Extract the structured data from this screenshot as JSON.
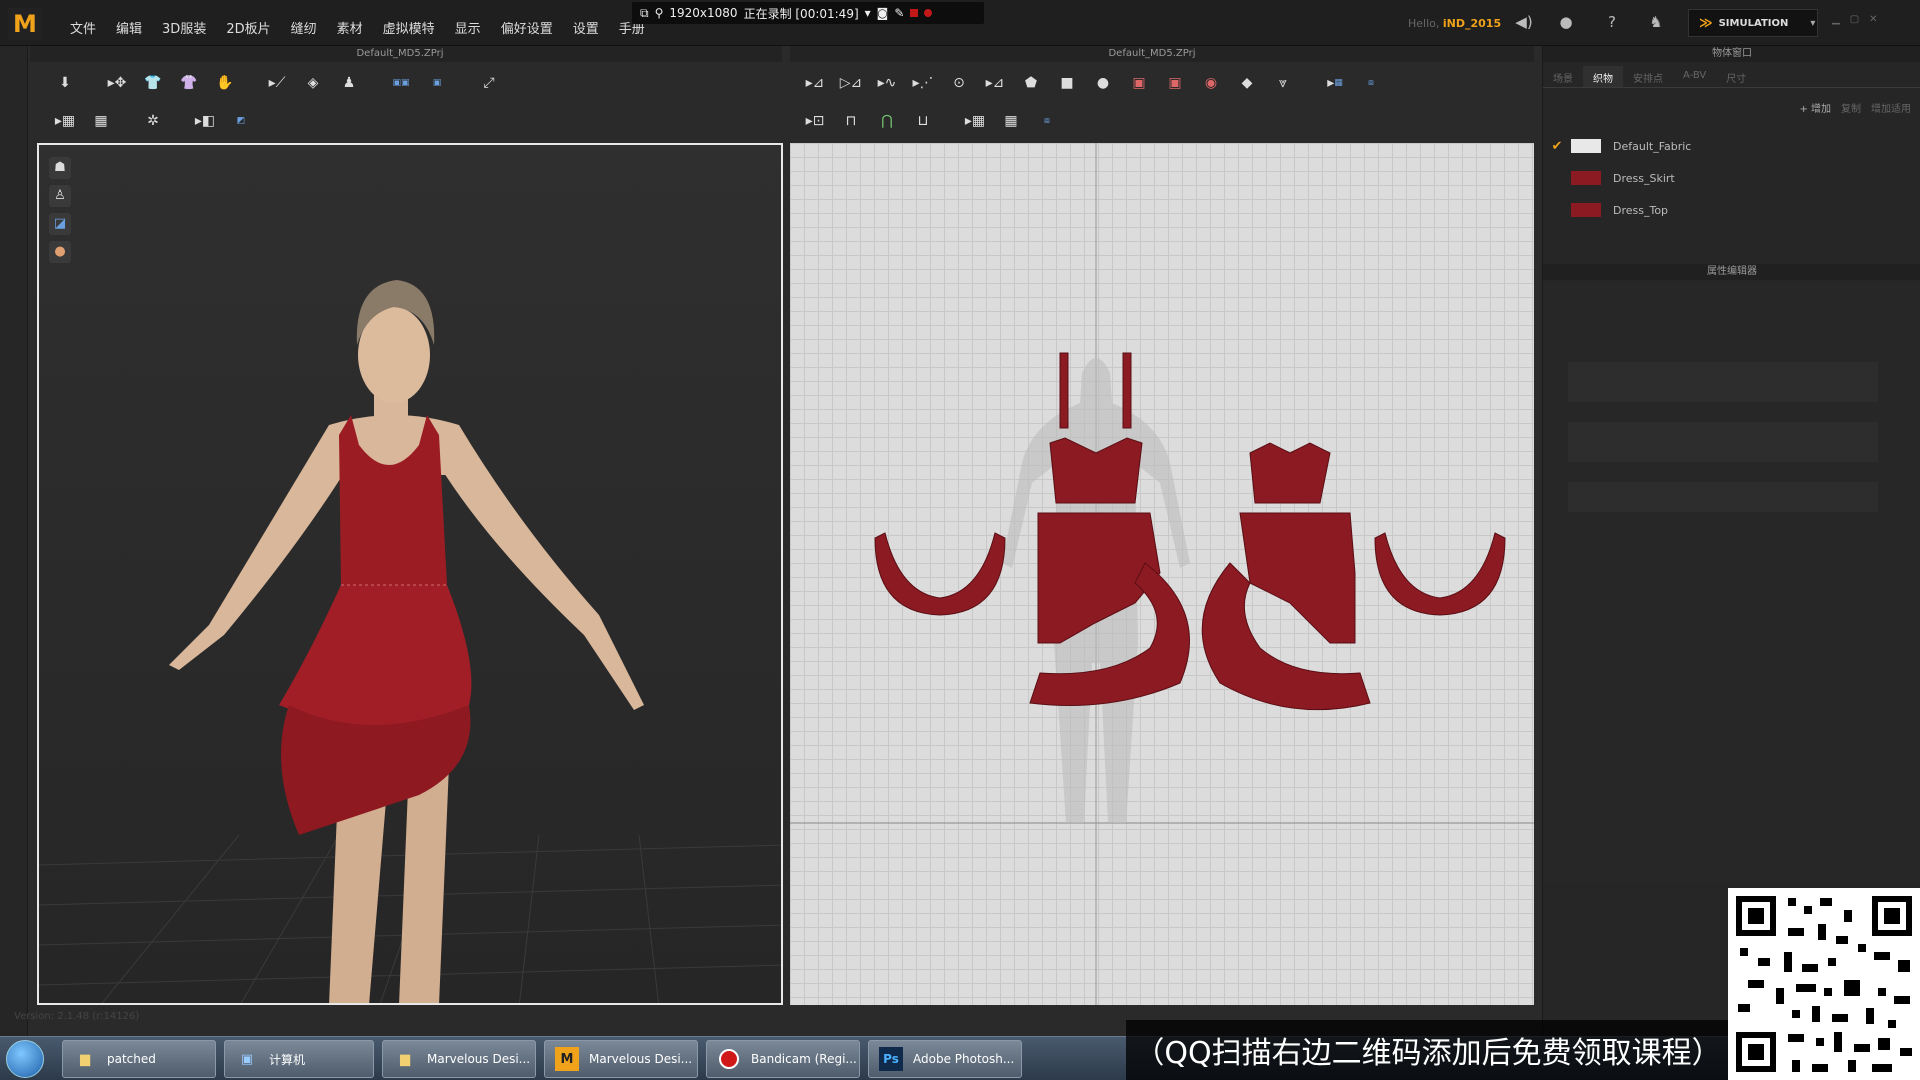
{
  "app": {
    "logo": "M",
    "menu": [
      "文件",
      "编辑",
      "3D服装",
      "2D板片",
      "缝纫",
      "素材",
      "虚拟模特",
      "显示",
      "偏好设置",
      "设置",
      "手册"
    ],
    "user_greeting": "Hello,",
    "user_name": "iND_2015",
    "simulation_label": "SIMULATION",
    "version": "Version: 2.1.48   (r:14126)"
  },
  "recording": {
    "resolution": "1920x1080",
    "status": "正在录制 [00:01:49]"
  },
  "viewport3d": {
    "title": "Default_MD5.ZPrj"
  },
  "viewport2d": {
    "title": "Default_MD5.ZPrj"
  },
  "object_window": {
    "title": "物体窗口",
    "tabs": [
      "场景",
      "织物",
      "安排点",
      "A-BV",
      "尺寸"
    ],
    "active_tab": 1,
    "actions": [
      "+ 增加",
      "复制",
      "增加适用"
    ],
    "fabrics": [
      {
        "name": "Default_Fabric",
        "color": "#e8e8e8",
        "checked": true
      },
      {
        "name": "Dress_Skirt",
        "color": "#8b1a22",
        "checked": false
      },
      {
        "name": "Dress_Top",
        "color": "#8b1a22",
        "checked": false
      }
    ]
  },
  "property_editor": {
    "title": "属性编辑器"
  },
  "taskbar": {
    "items": [
      {
        "label": "patched",
        "icon": "folder-icon"
      },
      {
        "label": "计算机",
        "icon": "computer-icon"
      },
      {
        "label": "Marvelous Desi...",
        "icon": "folder-icon"
      },
      {
        "label": "Marvelous Desi...",
        "icon": "marvelous-icon"
      },
      {
        "label": "Bandicam (Regi...",
        "icon": "record-icon"
      },
      {
        "label": "Adobe Photosh...",
        "icon": "photoshop-icon"
      }
    ]
  },
  "promo_text": "（QQ扫描右边二维码添加后免费领取课程）",
  "colors": {
    "accent": "#f0a21a",
    "fabric_red": "#8b1a22",
    "viewport_border": "#e8e8e8"
  }
}
